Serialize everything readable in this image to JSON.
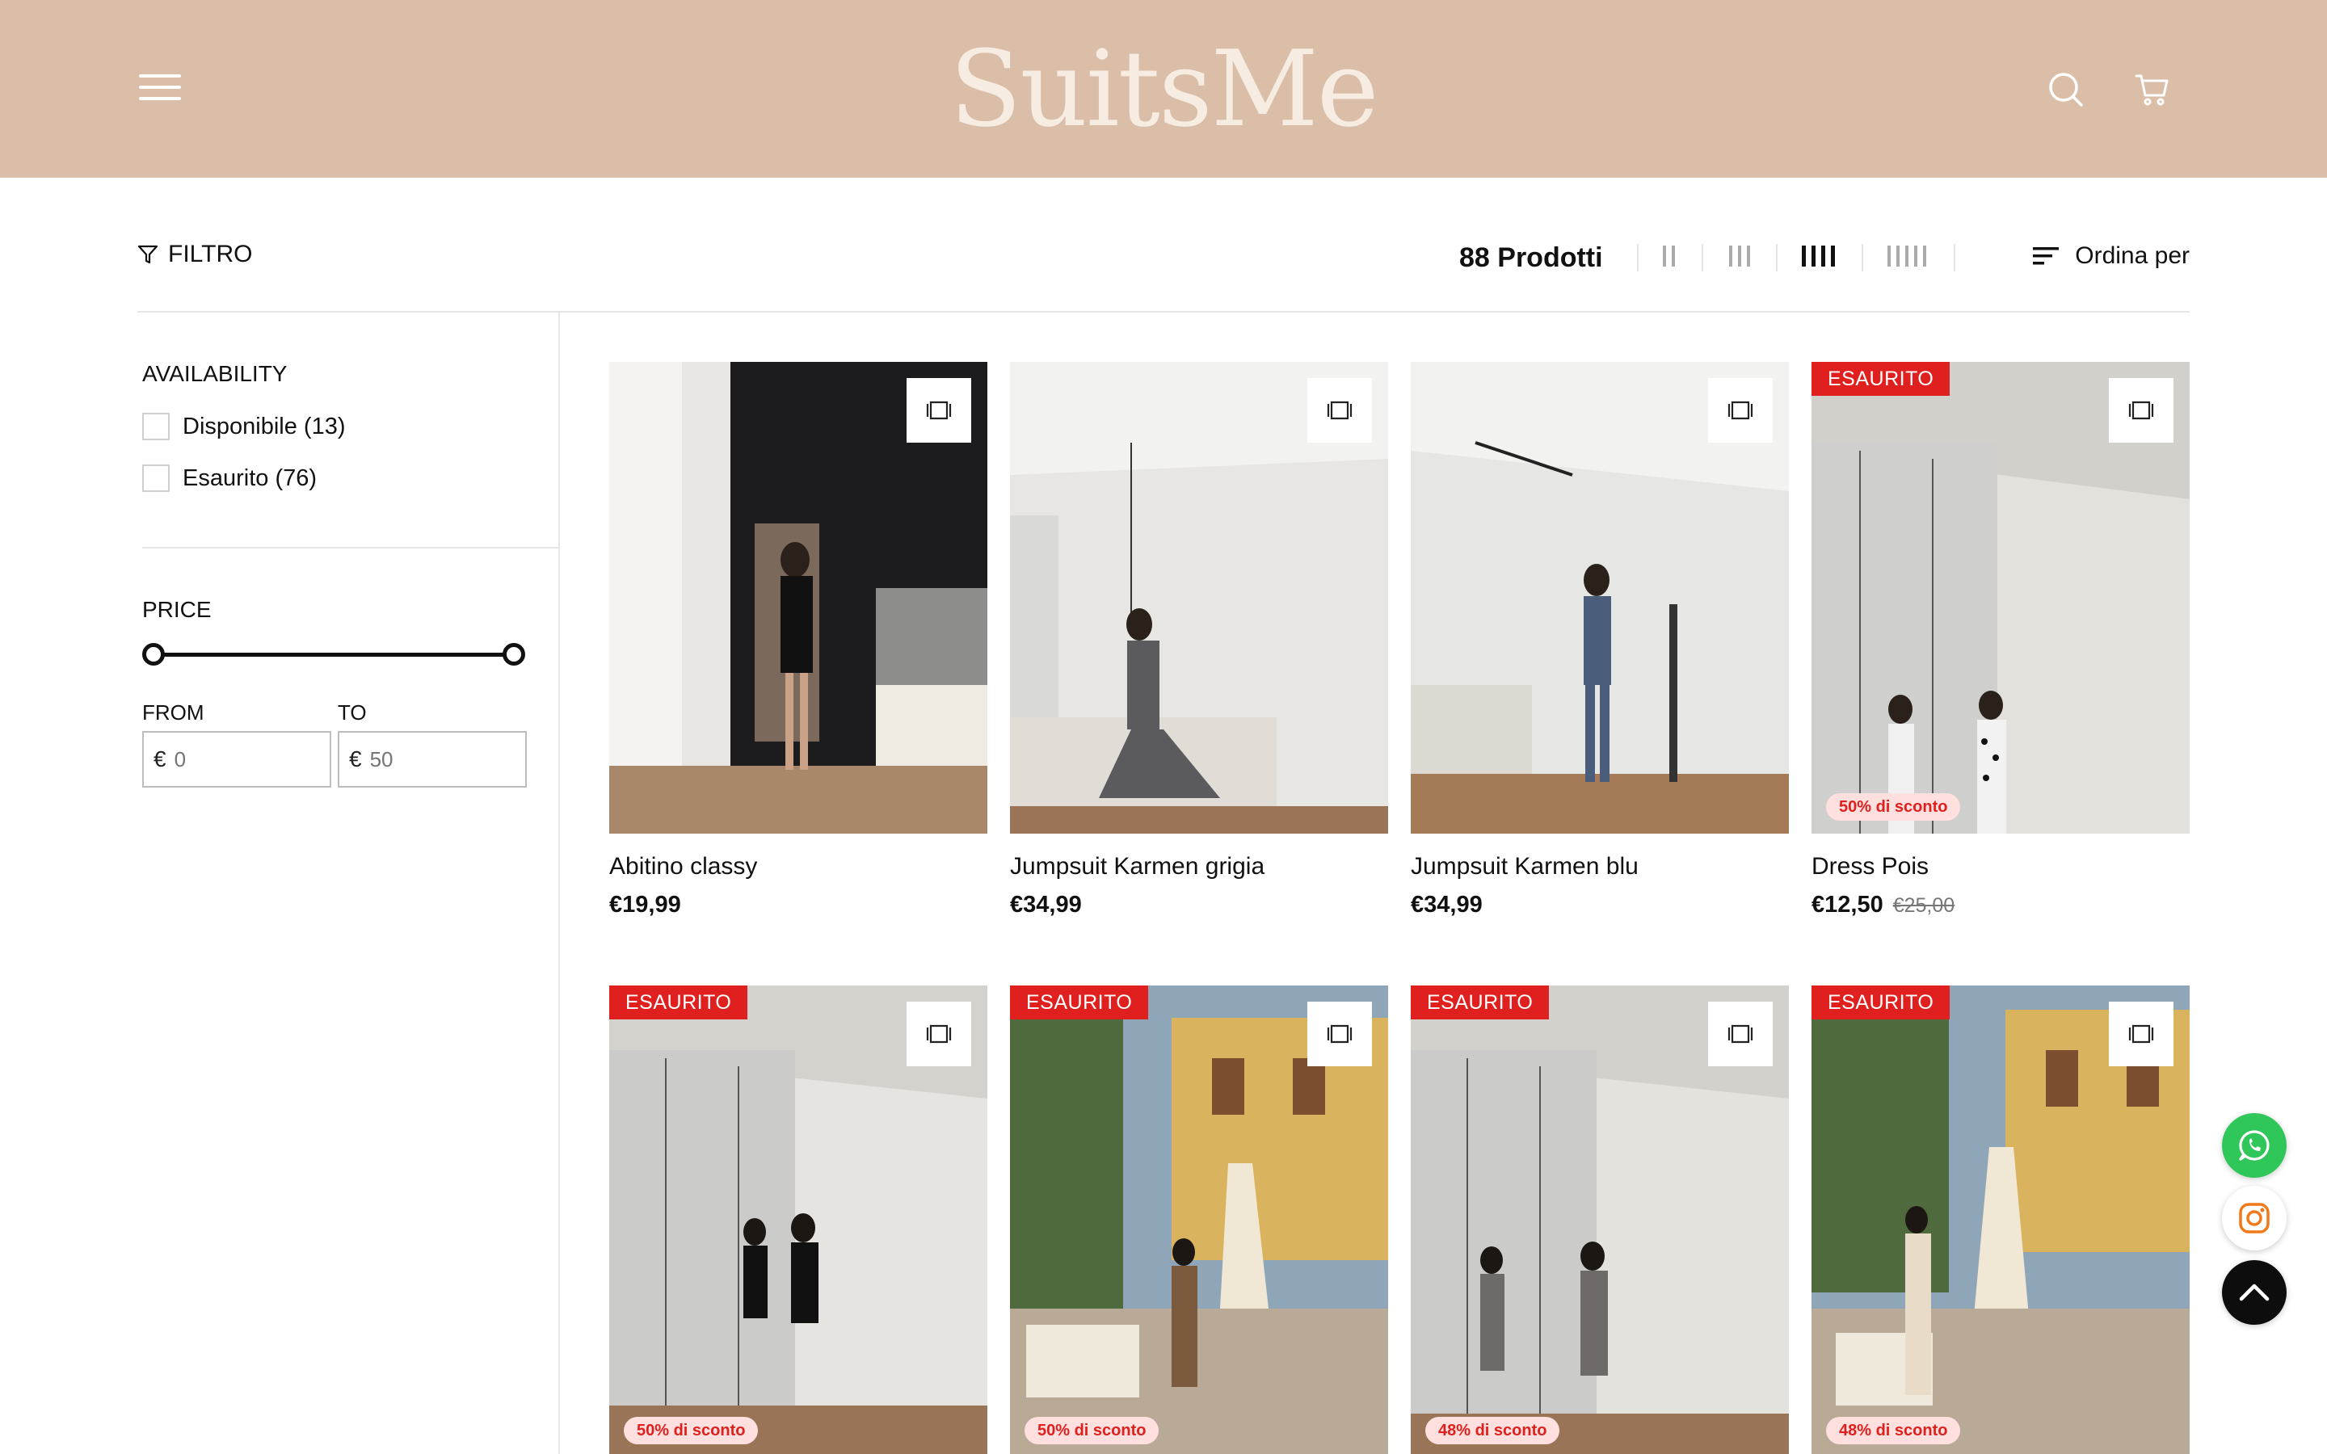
{
  "header": {
    "logo": "SuitsMe",
    "background_color": "#dbbea8",
    "icons": [
      "menu-icon",
      "search-icon",
      "cart-icon"
    ]
  },
  "toolbar": {
    "filter_label": "FILTRO",
    "product_count": "88 Prodotti",
    "grid_options": [
      "2 columns",
      "3 columns",
      "4 columns",
      "5 columns"
    ],
    "active_grid": "4 columns",
    "sort_label": "Ordina per"
  },
  "sidebar": {
    "availability": {
      "title": "AVAILABILITY",
      "options": [
        {
          "label": "Disponibile (13)",
          "checked": false
        },
        {
          "label": "Esaurito (76)",
          "checked": false
        }
      ]
    },
    "price": {
      "title": "PRICE",
      "from_label": "FROM",
      "to_label": "TO",
      "currency": "€",
      "from_placeholder": "0",
      "to_placeholder": "50",
      "range_min": 0,
      "range_max": 50
    }
  },
  "products": [
    {
      "name": "Abitino classy",
      "price": "€19,99",
      "old_price": "",
      "sold_out": false,
      "discount": ""
    },
    {
      "name": "Jumpsuit Karmen grigia",
      "price": "€34,99",
      "old_price": "",
      "sold_out": false,
      "discount": ""
    },
    {
      "name": "Jumpsuit Karmen blu",
      "price": "€34,99",
      "old_price": "",
      "sold_out": false,
      "discount": ""
    },
    {
      "name": "Dress Pois",
      "price": "€12,50",
      "old_price": "€25,00",
      "sold_out": true,
      "discount": "50% di sconto"
    },
    {
      "name": "",
      "price": "",
      "old_price": "",
      "sold_out": true,
      "discount": "50% di sconto"
    },
    {
      "name": "",
      "price": "",
      "old_price": "",
      "sold_out": true,
      "discount": "50% di sconto"
    },
    {
      "name": "",
      "price": "",
      "old_price": "",
      "sold_out": true,
      "discount": "48% di sconto"
    },
    {
      "name": "",
      "price": "",
      "old_price": "",
      "sold_out": true,
      "discount": "48% di sconto"
    }
  ],
  "sold_out_label": "ESAURITO",
  "floating": [
    "whatsapp-icon",
    "instagram-icon",
    "back-to-top-icon"
  ],
  "colors": {
    "sale_red": "#e0201e",
    "whatsapp_green": "#2fc65a",
    "instagram_orange": "#f07a1a"
  }
}
